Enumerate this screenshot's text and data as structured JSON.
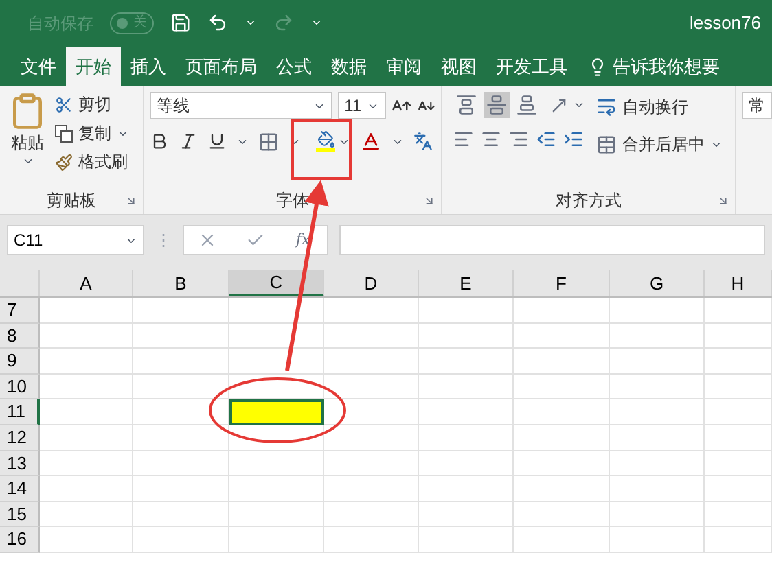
{
  "title_bar": {
    "autosave_label": "自动保存",
    "autosave_state": "关",
    "autosave_on": false,
    "redo_disabled": true,
    "title": "lesson76"
  },
  "tabs": [
    {
      "label": "文件",
      "selected": false
    },
    {
      "label": "开始",
      "selected": true
    },
    {
      "label": "插入",
      "selected": false
    },
    {
      "label": "页面布局",
      "selected": false
    },
    {
      "label": "公式",
      "selected": false
    },
    {
      "label": "数据",
      "selected": false
    },
    {
      "label": "审阅",
      "selected": false
    },
    {
      "label": "视图",
      "selected": false
    },
    {
      "label": "开发工具",
      "selected": false
    }
  ],
  "tell_me": "告诉我你想要",
  "clipboard": {
    "paste": "粘贴",
    "cut": "剪切",
    "copy": "复制",
    "format_painter": "格式刷",
    "label": "剪贴板"
  },
  "font": {
    "name": "等线",
    "size": "11",
    "label": "字体"
  },
  "alignment": {
    "vertical": [
      {
        "kind": "top",
        "selected": false
      },
      {
        "kind": "middle",
        "selected": true
      },
      {
        "kind": "bottom",
        "selected": false
      }
    ],
    "wrap": "自动换行",
    "merge": "合并后居中",
    "label": "对齐方式"
  },
  "number": {
    "format": "常"
  },
  "formula_bar": {
    "name_box": "C11",
    "grip": "⋮",
    "function_label": "fx"
  },
  "grid": {
    "columns": [
      {
        "label": "A",
        "selected": false
      },
      {
        "label": "B",
        "selected": false
      },
      {
        "label": "C",
        "selected": true
      },
      {
        "label": "D",
        "selected": false
      },
      {
        "label": "E",
        "selected": false
      },
      {
        "label": "F",
        "selected": false
      },
      {
        "label": "G",
        "selected": false
      },
      {
        "label": "H",
        "selected": false
      }
    ],
    "rows": [
      {
        "label": "7",
        "selected": false
      },
      {
        "label": "8",
        "selected": false
      },
      {
        "label": "9",
        "selected": false
      },
      {
        "label": "10",
        "selected": false
      },
      {
        "label": "11",
        "selected": true
      },
      {
        "label": "12",
        "selected": false
      },
      {
        "label": "13",
        "selected": false
      },
      {
        "label": "14",
        "selected": false
      },
      {
        "label": "15",
        "selected": false
      },
      {
        "label": "16",
        "selected": false
      }
    ],
    "selected_cell_filled": true
  }
}
